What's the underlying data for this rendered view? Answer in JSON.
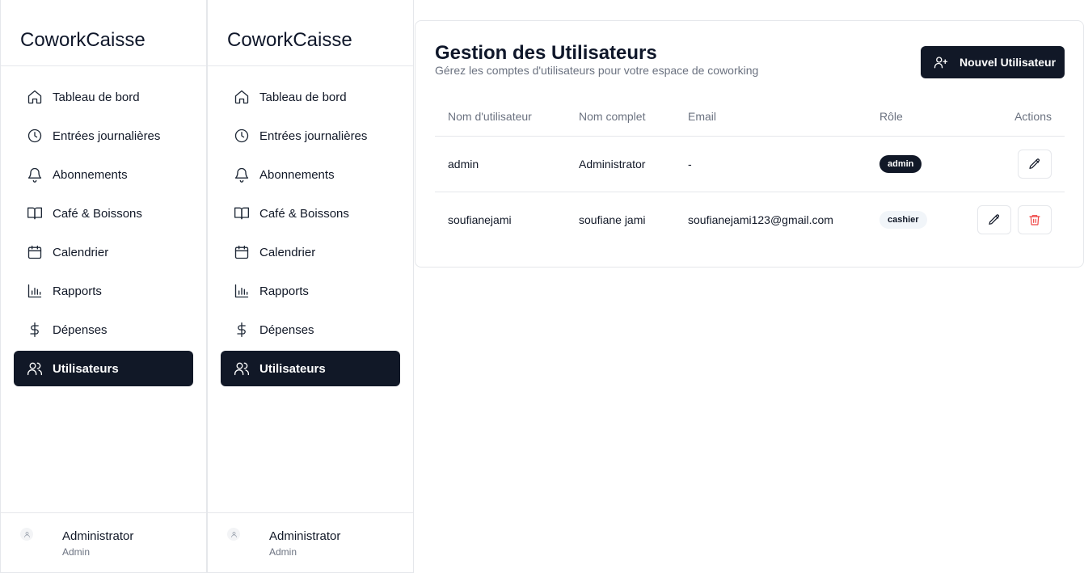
{
  "app": {
    "brand": "CoworkCaisse"
  },
  "sidebar": {
    "items": [
      {
        "label": "Tableau de bord",
        "icon": "home-icon"
      },
      {
        "label": "Entrées journalières",
        "icon": "clock-icon"
      },
      {
        "label": "Abonnements",
        "icon": "bell-icon"
      },
      {
        "label": "Café & Boissons",
        "icon": "book-icon"
      },
      {
        "label": "Calendrier",
        "icon": "calendar-icon"
      },
      {
        "label": "Rapports",
        "icon": "bar-chart-icon"
      },
      {
        "label": "Dépenses",
        "icon": "dollar-icon"
      },
      {
        "label": "Utilisateurs",
        "icon": "users-icon",
        "active": true
      }
    ],
    "user": {
      "name": "Administrator",
      "role": "Admin"
    }
  },
  "main": {
    "title": "Gestion des Utilisateurs",
    "subtitle": "Gérez les comptes d'utilisateurs pour votre espace de coworking",
    "new_user_label": "Nouvel Utilisateur",
    "table": {
      "headers": {
        "username": "Nom d'utilisateur",
        "fullname": "Nom complet",
        "email": "Email",
        "role": "Rôle",
        "actions": "Actions"
      },
      "rows": [
        {
          "username": "admin",
          "fullname": "Administrator",
          "email": "-",
          "role": "admin"
        },
        {
          "username": "soufianejami",
          "fullname": "soufiane jami",
          "email": "soufianejami123@gmail.com",
          "role": "cashier"
        }
      ]
    }
  },
  "colors": {
    "accent": "#111827",
    "danger": "#ef4444",
    "border": "#e5e7eb",
    "muted": "#6b7280"
  }
}
